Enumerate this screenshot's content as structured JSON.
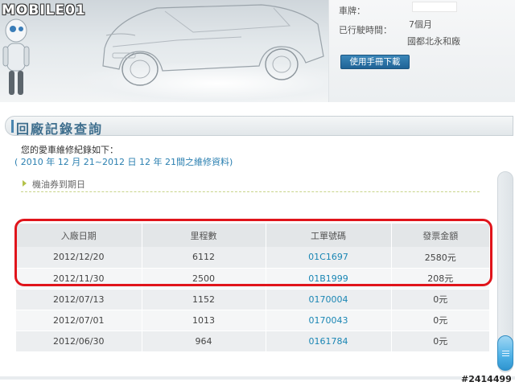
{
  "header": {
    "logo_text": "MOBILE01",
    "plate_label": "車牌：",
    "plate_value": "",
    "age_label": "已行駛時間：",
    "age_value": "7個月",
    "dealer_value": "國都北永和廠",
    "manual_button": "使用手冊下載"
  },
  "section": {
    "title": "回廠記錄查詢",
    "intro": "您的愛車維修紀錄如下：",
    "range": "( 2010 年 12 月 21~2012 日 12 年 21間之維修資料)",
    "expand_label": "機油券到期日"
  },
  "table": {
    "columns": [
      "入廠日期",
      "里程數",
      "工單號碼",
      "發票金額"
    ],
    "rows": [
      {
        "date": "2012/12/20",
        "mileage": "6112",
        "order": "01C1697",
        "amount": "2580元"
      },
      {
        "date": "2012/11/30",
        "mileage": "2500",
        "order": "01B1999",
        "amount": "208元"
      },
      {
        "date": "2012/07/13",
        "mileage": "1152",
        "order": "0170004",
        "amount": "0元"
      },
      {
        "date": "2012/07/01",
        "mileage": "1013",
        "order": "0170043",
        "amount": "0元"
      },
      {
        "date": "2012/06/30",
        "mileage": "964",
        "order": "0161784",
        "amount": "0元"
      }
    ]
  },
  "watermark": "#2414499",
  "colors": {
    "accent": "#2a7fb0",
    "highlight": "#e0141b",
    "button": "#1f6396",
    "link": "#1a86b4"
  }
}
